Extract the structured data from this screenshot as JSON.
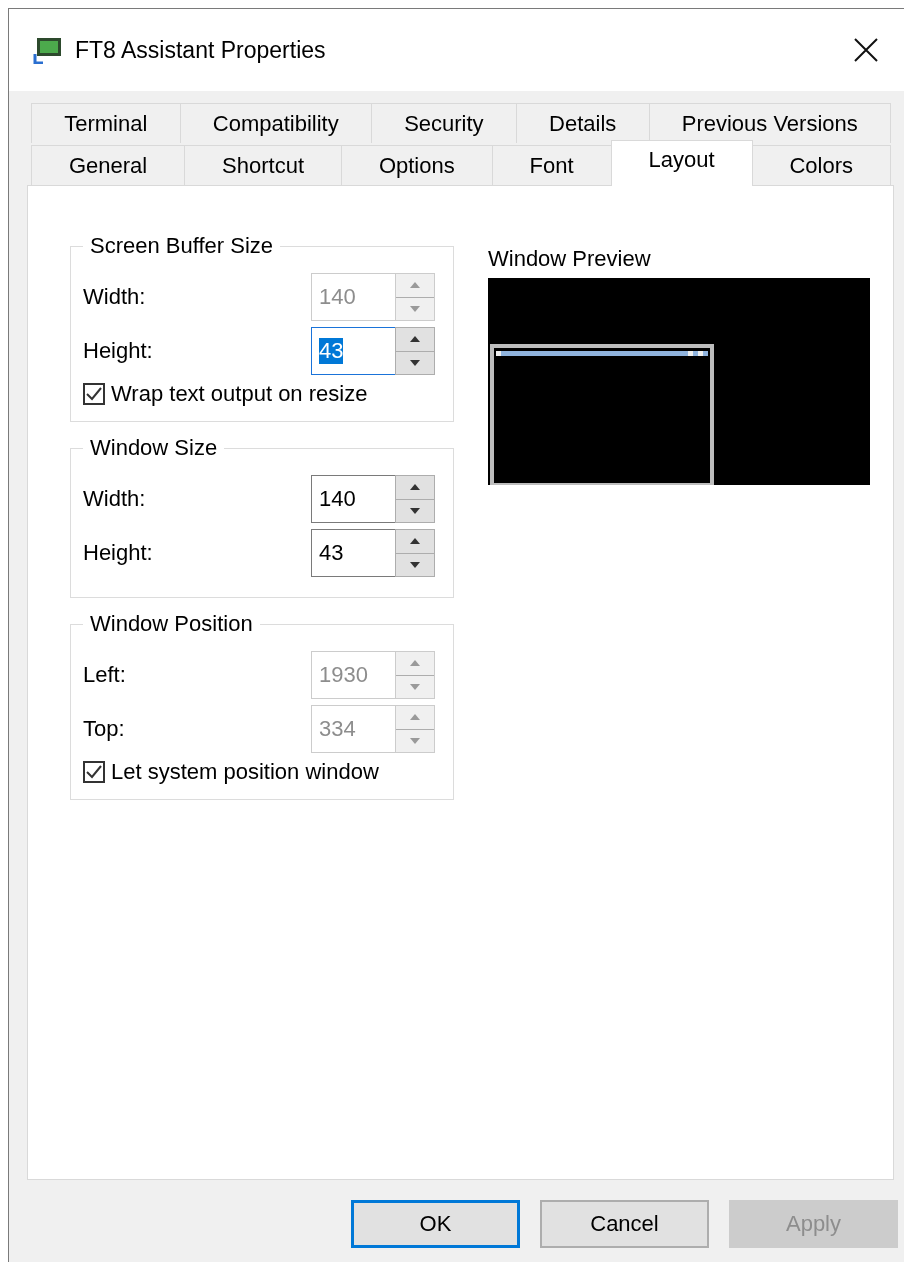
{
  "window": {
    "title": "FT8 Assistant Properties"
  },
  "tab_rows": [
    [
      {
        "label": "Terminal",
        "selected": false
      },
      {
        "label": "Compatibility",
        "selected": false
      },
      {
        "label": "Security",
        "selected": false
      },
      {
        "label": "Details",
        "selected": false
      },
      {
        "label": "Previous Versions",
        "selected": false
      }
    ],
    [
      {
        "label": "General",
        "selected": false
      },
      {
        "label": "Shortcut",
        "selected": false
      },
      {
        "label": "Options",
        "selected": false
      },
      {
        "label": "Font",
        "selected": false
      },
      {
        "label": "Layout",
        "selected": true
      },
      {
        "label": "Colors",
        "selected": false
      }
    ]
  ],
  "groups": [
    {
      "title": "Screen Buffer Size",
      "fields": [
        {
          "label": "Width:",
          "value": "140",
          "disabled": true,
          "focused": false
        },
        {
          "label": "Height:",
          "value": "43",
          "disabled": false,
          "focused": true
        }
      ],
      "checkbox": {
        "label": "Wrap text output on resize",
        "checked": true
      }
    },
    {
      "title": "Window Size",
      "fields": [
        {
          "label": "Width:",
          "value": "140",
          "disabled": false,
          "focused": false
        },
        {
          "label": "Height:",
          "value": "43",
          "disabled": false,
          "focused": false
        }
      ]
    },
    {
      "title": "Window Position",
      "fields": [
        {
          "label": "Left:",
          "value": "1930",
          "disabled": true,
          "focused": false
        },
        {
          "label": "Top:",
          "value": "334",
          "disabled": true,
          "focused": false
        }
      ],
      "checkbox": {
        "label": "Let system position window",
        "checked": true
      }
    }
  ],
  "preview": {
    "title": "Window Preview"
  },
  "buttons": [
    {
      "label": "OK",
      "default": true,
      "disabled": false
    },
    {
      "label": "Cancel",
      "default": false,
      "disabled": false
    },
    {
      "label": "Apply",
      "default": false,
      "disabled": true
    }
  ]
}
